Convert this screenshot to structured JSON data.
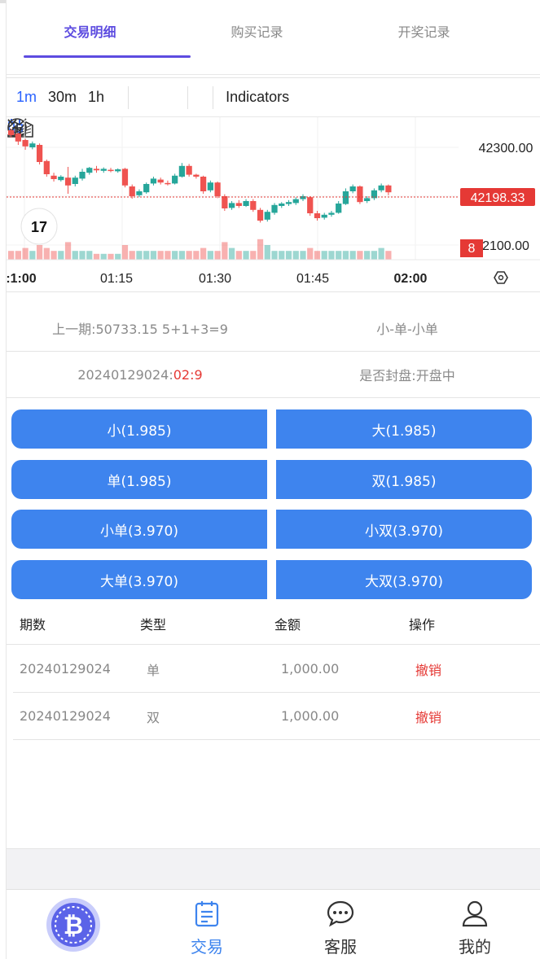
{
  "tabs": [
    {
      "label": "交易明细"
    },
    {
      "label": "购买记录"
    },
    {
      "label": "开奖记录"
    }
  ],
  "chart_toolbar": {
    "intervals": [
      "1m",
      "30m",
      "1h"
    ],
    "indicators_label": "Indicators"
  },
  "chart_data": {
    "type": "candlestick",
    "x_ticks": [
      ":1:00",
      "01:15",
      "01:30",
      "01:45",
      "02:00"
    ],
    "y_ticks": [
      42300.0,
      42100.0
    ],
    "last_price": "42198.33",
    "volume_badge": "8",
    "y_tick_labels": [
      "42300.00",
      "2100.00"
    ],
    "x_tick_labels": [
      ":1:00",
      "01:15",
      "01:30",
      "01:45",
      "02:00"
    ],
    "candles": [
      {
        "o": 42335,
        "c": 42325,
        "h": 42338,
        "l": 42320
      },
      {
        "o": 42328,
        "c": 42312,
        "h": 42330,
        "l": 42305
      },
      {
        "o": 42315,
        "c": 42302,
        "h": 42318,
        "l": 42295
      },
      {
        "o": 42300,
        "c": 42308,
        "h": 42312,
        "l": 42296
      },
      {
        "o": 42305,
        "c": 42270,
        "h": 42308,
        "l": 42265
      },
      {
        "o": 42272,
        "c": 42245,
        "h": 42275,
        "l": 42240
      },
      {
        "o": 42242,
        "c": 42235,
        "h": 42248,
        "l": 42230
      },
      {
        "o": 42233,
        "c": 42240,
        "h": 42243,
        "l": 42230
      },
      {
        "o": 42238,
        "c": 42222,
        "h": 42260,
        "l": 42205
      },
      {
        "o": 42225,
        "c": 42238,
        "h": 42242,
        "l": 42220
      },
      {
        "o": 42236,
        "c": 42250,
        "h": 42256,
        "l": 42232
      },
      {
        "o": 42248,
        "c": 42258,
        "h": 42260,
        "l": 42244
      },
      {
        "o": 42256,
        "c": 42253,
        "h": 42262,
        "l": 42248
      },
      {
        "o": 42252,
        "c": 42256,
        "h": 42259,
        "l": 42248
      },
      {
        "o": 42254,
        "c": 42252,
        "h": 42258,
        "l": 42249
      },
      {
        "o": 42251,
        "c": 42255,
        "h": 42257,
        "l": 42248
      },
      {
        "o": 42256,
        "c": 42222,
        "h": 42258,
        "l": 42218
      },
      {
        "o": 42220,
        "c": 42200,
        "h": 42224,
        "l": 42195
      },
      {
        "o": 42202,
        "c": 42210,
        "h": 42214,
        "l": 42198
      },
      {
        "o": 42208,
        "c": 42225,
        "h": 42228,
        "l": 42205
      },
      {
        "o": 42226,
        "c": 42236,
        "h": 42240,
        "l": 42222
      },
      {
        "o": 42234,
        "c": 42228,
        "h": 42238,
        "l": 42224
      },
      {
        "o": 42227,
        "c": 42225,
        "h": 42232,
        "l": 42222
      },
      {
        "o": 42226,
        "c": 42242,
        "h": 42246,
        "l": 42224
      },
      {
        "o": 42240,
        "c": 42262,
        "h": 42268,
        "l": 42238
      },
      {
        "o": 42262,
        "c": 42244,
        "h": 42266,
        "l": 42240
      },
      {
        "o": 42244,
        "c": 42240,
        "h": 42246,
        "l": 42236
      },
      {
        "o": 42240,
        "c": 42210,
        "h": 42242,
        "l": 42205
      },
      {
        "o": 42212,
        "c": 42228,
        "h": 42232,
        "l": 42208
      },
      {
        "o": 42228,
        "c": 42200,
        "h": 42230,
        "l": 42196
      },
      {
        "o": 42200,
        "c": 42175,
        "h": 42204,
        "l": 42170
      },
      {
        "o": 42176,
        "c": 42186,
        "h": 42190,
        "l": 42172
      },
      {
        "o": 42186,
        "c": 42180,
        "h": 42192,
        "l": 42176
      },
      {
        "o": 42180,
        "c": 42190,
        "h": 42194,
        "l": 42178
      },
      {
        "o": 42190,
        "c": 42172,
        "h": 42194,
        "l": 42168
      },
      {
        "o": 42172,
        "c": 42150,
        "h": 42176,
        "l": 42146
      },
      {
        "o": 42152,
        "c": 42168,
        "h": 42172,
        "l": 42148
      },
      {
        "o": 42166,
        "c": 42182,
        "h": 42186,
        "l": 42162
      },
      {
        "o": 42180,
        "c": 42185,
        "h": 42188,
        "l": 42176
      },
      {
        "o": 42184,
        "c": 42188,
        "h": 42192,
        "l": 42180
      },
      {
        "o": 42186,
        "c": 42194,
        "h": 42198,
        "l": 42182
      },
      {
        "o": 42194,
        "c": 42200,
        "h": 42204,
        "l": 42190
      },
      {
        "o": 42198,
        "c": 42165,
        "h": 42200,
        "l": 42160
      },
      {
        "o": 42165,
        "c": 42155,
        "h": 42170,
        "l": 42150
      },
      {
        "o": 42156,
        "c": 42162,
        "h": 42166,
        "l": 42152
      },
      {
        "o": 42162,
        "c": 42166,
        "h": 42170,
        "l": 42158
      },
      {
        "o": 42166,
        "c": 42185,
        "h": 42190,
        "l": 42164
      },
      {
        "o": 42184,
        "c": 42210,
        "h": 42216,
        "l": 42182
      },
      {
        "o": 42210,
        "c": 42220,
        "h": 42224,
        "l": 42206
      },
      {
        "o": 42220,
        "c": 42188,
        "h": 42222,
        "l": 42184
      },
      {
        "o": 42190,
        "c": 42196,
        "h": 42200,
        "l": 42186
      },
      {
        "o": 42196,
        "c": 42212,
        "h": 42216,
        "l": 42192
      },
      {
        "o": 42212,
        "c": 42222,
        "h": 42226,
        "l": 42208
      },
      {
        "o": 42222,
        "c": 42208,
        "h": 42224,
        "l": 42202
      }
    ],
    "volumes": [
      3,
      3,
      4,
      3,
      5,
      4,
      3,
      3,
      6,
      3,
      3,
      3,
      2,
      2,
      2,
      2,
      5,
      3,
      3,
      3,
      3,
      3,
      3,
      3,
      3,
      3,
      3,
      4,
      3,
      3,
      6,
      4,
      3,
      3,
      3,
      7,
      5,
      3,
      3,
      3,
      3,
      3,
      4,
      3,
      3,
      3,
      3,
      3,
      3,
      3,
      3,
      3,
      4,
      3
    ]
  },
  "draw": {
    "tabs_active": 0,
    "last_price_color": "#e53935",
    "up_color": "#26a69a",
    "down_color": "#ef5350"
  },
  "info": {
    "prev_label": "上一期:50733.15 5+1+3=9",
    "prev_result": "小-单-小单",
    "period_id": "20240129024:",
    "countdown": "02:9",
    "closed_status": "是否封盘:开盘中"
  },
  "bets": [
    {
      "label": "小(1.985)"
    },
    {
      "label": "大(1.985)"
    },
    {
      "label": "单(1.985)"
    },
    {
      "label": "双(1.985)"
    },
    {
      "label": "小单(3.970)"
    },
    {
      "label": "小双(3.970)"
    },
    {
      "label": "大单(3.970)"
    },
    {
      "label": "大双(3.970)"
    }
  ],
  "table": {
    "headers": [
      "期数",
      "类型",
      "金额",
      "操作"
    ],
    "rows": [
      {
        "period": "20240129024",
        "type": "单",
        "amount": "1,000.00",
        "action": "撤销"
      },
      {
        "period": "20240129024",
        "type": "双",
        "amount": "1,000.00",
        "action": "撤销"
      }
    ]
  },
  "nav": [
    {
      "label": "",
      "icon": "bitcoin-icon"
    },
    {
      "label": "交易",
      "icon": "document-icon"
    },
    {
      "label": "客服",
      "icon": "chat-icon"
    },
    {
      "label": "我的",
      "icon": "user-icon"
    }
  ]
}
